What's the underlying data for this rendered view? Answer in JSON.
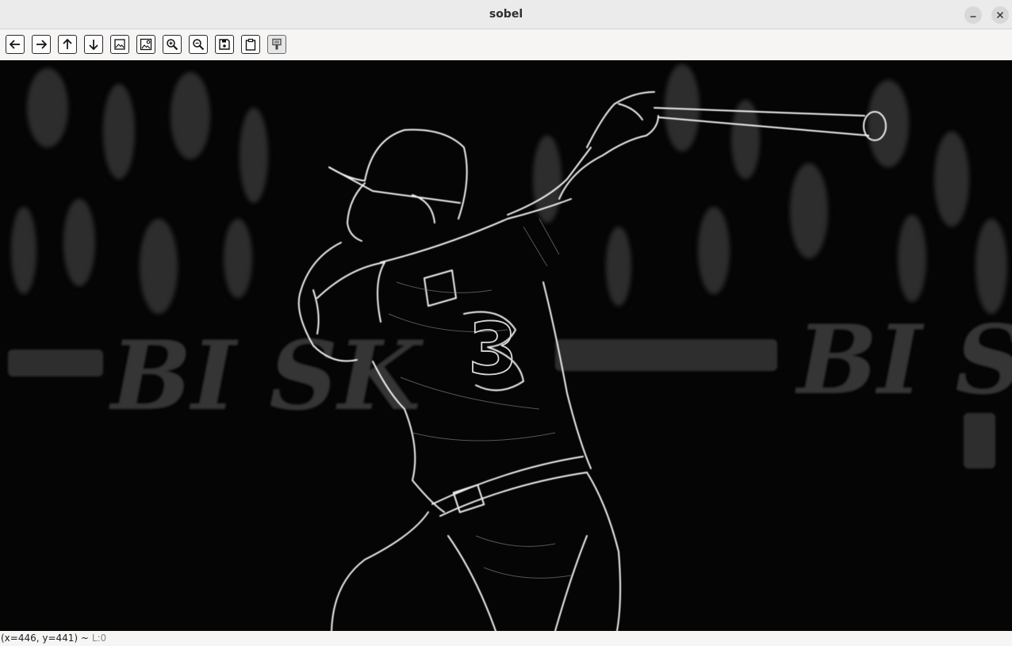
{
  "window": {
    "title": "sobel"
  },
  "toolbar": {
    "buttons": [
      {
        "icon": "arrow-left-icon"
      },
      {
        "icon": "arrow-right-icon"
      },
      {
        "icon": "arrow-up-icon"
      },
      {
        "icon": "arrow-down-icon"
      },
      {
        "icon": "image-icon"
      },
      {
        "icon": "image-settings-icon"
      },
      {
        "icon": "zoom-in-icon"
      },
      {
        "icon": "zoom-out-icon"
      },
      {
        "icon": "save-icon"
      },
      {
        "icon": "clipboard-icon"
      },
      {
        "icon": "properties-icon"
      }
    ]
  },
  "canvas": {
    "content": "sobel edge-filtered image of a baseball batter",
    "overlay_text_left": "BI SK",
    "overlay_text_right": "BI SK",
    "jersey_number": "3",
    "colors": {
      "background": "#050505",
      "edges": "#f2f2f2",
      "background_text": "#3a3a3a"
    }
  },
  "status": {
    "coords": "(x=446, y=441) ~",
    "level": "L:0"
  }
}
